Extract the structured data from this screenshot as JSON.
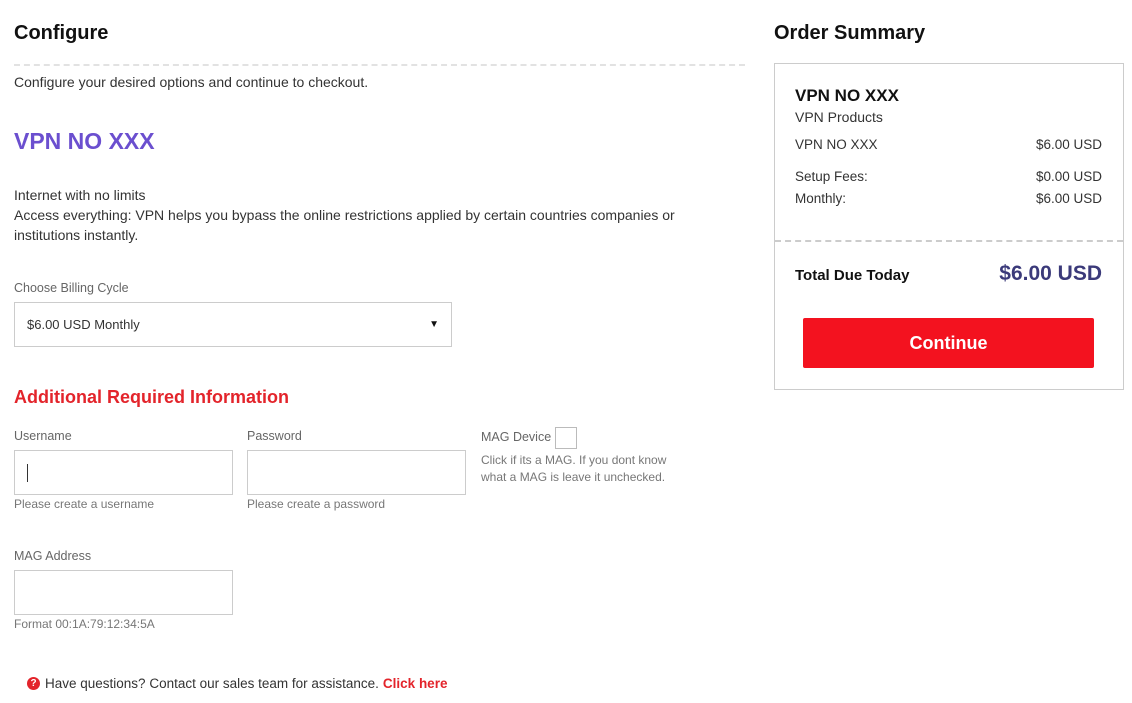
{
  "configure": {
    "title": "Configure",
    "intro": "Configure your desired options and continue to checkout.",
    "product_title": "VPN NO XXX",
    "description_line1": "Internet with no limits",
    "description_line2": "Access everything: VPN helps you bypass the online restrictions applied by certain countries companies or institutions instantly.",
    "billing": {
      "label": "Choose Billing Cycle",
      "selected": "$6.00 USD Monthly"
    },
    "additional": {
      "title": "Additional Required Information",
      "username_label": "Username",
      "username_help": "Please create a username",
      "password_label": "Password",
      "password_help": "Please create a password",
      "mag_device_label": "MAG Device",
      "mag_device_help": "Click if its a MAG. If you dont know what a MAG is leave it unchecked.",
      "mag_address_label": "MAG Address",
      "mag_address_help": "Format 00:1A:79:12:34:5A"
    },
    "questions": {
      "text": "Have questions? Contact our sales team for assistance.",
      "link": "Click here"
    }
  },
  "summary": {
    "title": "Order Summary",
    "product": "VPN NO XXX",
    "group": "VPN Products",
    "line_item_label": "VPN NO XXX",
    "line_item_value": "$6.00 USD",
    "setup_label": "Setup Fees:",
    "setup_value": "$0.00 USD",
    "monthly_label": "Monthly:",
    "monthly_value": "$6.00 USD",
    "total_label": "Total Due Today",
    "total_value": "$6.00 USD",
    "continue_label": "Continue"
  },
  "colors": {
    "accent_purple": "#6b4fcf",
    "accent_red": "#e3242b",
    "button_red": "#f3121f",
    "total_navy": "#3b3a7a"
  }
}
